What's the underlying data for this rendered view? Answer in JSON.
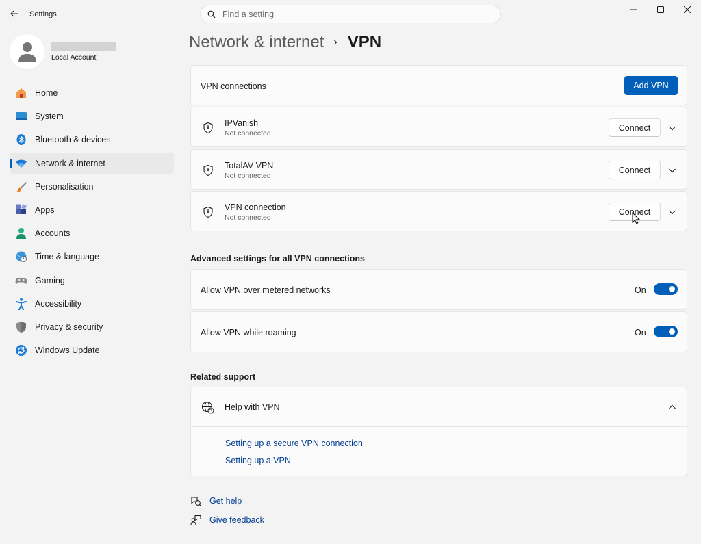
{
  "window": {
    "app_title": "Settings"
  },
  "search": {
    "placeholder": "Find a setting"
  },
  "profile": {
    "account_type": "Local Account"
  },
  "sidebar": {
    "items": [
      {
        "label": "Home",
        "icon": "home-icon"
      },
      {
        "label": "System",
        "icon": "monitor-icon"
      },
      {
        "label": "Bluetooth & devices",
        "icon": "bluetooth-icon"
      },
      {
        "label": "Network & internet",
        "icon": "wifi-icon",
        "active": true
      },
      {
        "label": "Personalisation",
        "icon": "paintbrush-icon"
      },
      {
        "label": "Apps",
        "icon": "apps-icon"
      },
      {
        "label": "Accounts",
        "icon": "person-icon"
      },
      {
        "label": "Time & language",
        "icon": "globe-clock-icon"
      },
      {
        "label": "Gaming",
        "icon": "gamepad-icon"
      },
      {
        "label": "Accessibility",
        "icon": "accessibility-icon"
      },
      {
        "label": "Privacy & security",
        "icon": "shield-icon"
      },
      {
        "label": "Windows Update",
        "icon": "update-icon"
      }
    ]
  },
  "breadcrumb": {
    "parent": "Network & internet",
    "separator": "›",
    "current": "VPN"
  },
  "vpn": {
    "connections_label": "VPN connections",
    "add_button": "Add VPN",
    "items": [
      {
        "name": "IPVanish",
        "status": "Not connected",
        "button": "Connect"
      },
      {
        "name": "TotalAV VPN",
        "status": "Not connected",
        "button": "Connect"
      },
      {
        "name": "VPN connection",
        "status": "Not connected",
        "button": "Connect"
      }
    ]
  },
  "advanced": {
    "heading": "Advanced settings for all VPN connections",
    "settings": [
      {
        "label": "Allow VPN over metered networks",
        "state": "On",
        "on": true
      },
      {
        "label": "Allow VPN while roaming",
        "state": "On",
        "on": true
      }
    ]
  },
  "support": {
    "heading": "Related support",
    "help_title": "Help with VPN",
    "links": [
      "Setting up a secure VPN connection",
      "Setting up a VPN"
    ]
  },
  "footer": {
    "get_help": "Get help",
    "give_feedback": "Give feedback"
  },
  "colors": {
    "accent": "#005fb8",
    "link": "#003e92",
    "background": "#f3f3f3",
    "card": "#fbfbfb"
  }
}
